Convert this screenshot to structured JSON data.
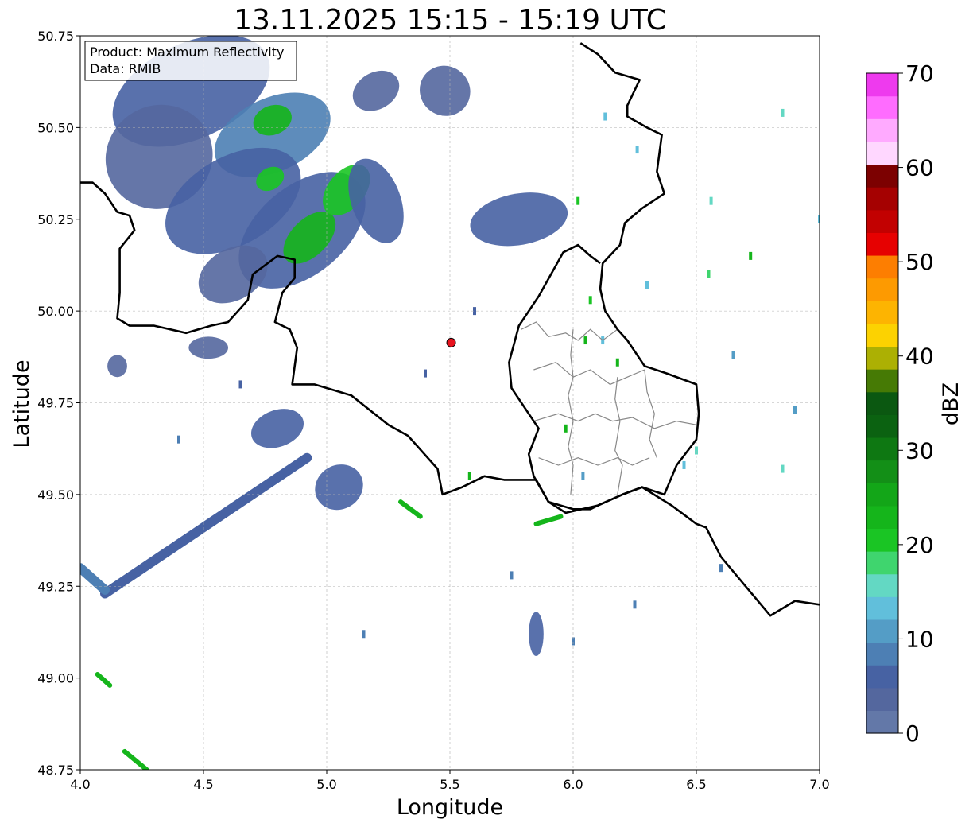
{
  "title": "13.11.2025 15:15 - 15:19 UTC",
  "info_box": {
    "product_line": "Product: Maximum Reflectivity",
    "data_line": "Data: RMIB"
  },
  "axes": {
    "xlabel": "Longitude",
    "ylabel": "Latitude",
    "xlim": [
      4.0,
      7.0
    ],
    "ylim": [
      48.75,
      50.75
    ],
    "xticks": [
      4.0,
      4.5,
      5.0,
      5.5,
      6.0,
      6.5,
      7.0
    ],
    "xtick_labels": [
      "4.0",
      "4.5",
      "5.0",
      "5.5",
      "6.0",
      "6.5",
      "7.0"
    ],
    "yticks": [
      48.75,
      49.0,
      49.25,
      49.5,
      49.75,
      50.0,
      50.25,
      50.5,
      50.75
    ],
    "ytick_labels": [
      "48.75",
      "49.00",
      "49.25",
      "49.50",
      "49.75",
      "50.00",
      "50.25",
      "50.50",
      "50.75"
    ],
    "grid": true
  },
  "colorbar": {
    "label": "dBZ",
    "range": [
      0,
      70
    ],
    "tick_values": [
      0,
      10,
      20,
      30,
      40,
      50,
      60,
      70
    ],
    "tick_labels": [
      "0",
      "10",
      "20",
      "30",
      "40",
      "50",
      "60",
      "70"
    ],
    "colors": [
      "#6378a8",
      "#54679e",
      "#4762a3",
      "#4d7fb4",
      "#549dc6",
      "#61bfdb",
      "#63d8c3",
      "#3fd56e",
      "#1ac524",
      "#15b51b",
      "#13a618",
      "#138f17",
      "#0e7812",
      "#0b6211",
      "#0b5811",
      "#467a05",
      "#acb003",
      "#fcd201",
      "#fdb401",
      "#fd9a01",
      "#fd7e01",
      "#e60101",
      "#c20101",
      "#a50101",
      "#7c0101",
      "#ffd7ff",
      "#ffaaff",
      "#ff6cff",
      "#ee3aee"
    ]
  },
  "radar_site": {
    "lon": 5.505,
    "lat": 49.914,
    "color": "#e8141e"
  },
  "colors": {
    "border": "#000000",
    "admin_border": "#888888",
    "grid": "#b0b0b0"
  },
  "map": {
    "borders": [
      [
        [
          4.0,
          50.35
        ],
        [
          4.05,
          50.35
        ],
        [
          4.1,
          50.32
        ],
        [
          4.15,
          50.27
        ],
        [
          4.2,
          50.26
        ],
        [
          4.22,
          50.22
        ],
        [
          4.16,
          50.17
        ],
        [
          4.16,
          50.05
        ],
        [
          4.15,
          49.98
        ],
        [
          4.2,
          49.96
        ],
        [
          4.3,
          49.96
        ],
        [
          4.43,
          49.94
        ],
        [
          4.53,
          49.96
        ],
        [
          4.6,
          49.97
        ],
        [
          4.68,
          50.03
        ],
        [
          4.7,
          50.1
        ],
        [
          4.8,
          50.15
        ],
        [
          4.87,
          50.14
        ],
        [
          4.87,
          50.09
        ],
        [
          4.82,
          50.05
        ],
        [
          4.79,
          49.97
        ],
        [
          4.85,
          49.95
        ],
        [
          4.88,
          49.9
        ],
        [
          4.86,
          49.8
        ],
        [
          4.95,
          49.8
        ],
        [
          5.1,
          49.77
        ],
        [
          5.25,
          49.69
        ],
        [
          5.33,
          49.66
        ],
        [
          5.45,
          49.57
        ],
        [
          5.47,
          49.5
        ],
        [
          5.55,
          49.52
        ],
        [
          5.64,
          49.55
        ],
        [
          5.72,
          49.54
        ],
        [
          5.85,
          49.54
        ],
        [
          5.9,
          49.48
        ],
        [
          6.0,
          49.46
        ],
        [
          6.07,
          49.46
        ],
        [
          6.1,
          49.47
        ],
        [
          6.2,
          49.5
        ],
        [
          6.28,
          49.52
        ],
        [
          6.4,
          49.47
        ],
        [
          6.5,
          49.42
        ],
        [
          6.54,
          49.41
        ],
        [
          6.6,
          49.33
        ],
        [
          6.7,
          49.25
        ],
        [
          6.8,
          49.17
        ],
        [
          6.9,
          49.21
        ],
        [
          7.0,
          49.2
        ]
      ],
      [
        [
          6.03,
          50.73
        ],
        [
          6.1,
          50.7
        ],
        [
          6.17,
          50.65
        ],
        [
          6.27,
          50.63
        ],
        [
          6.22,
          50.56
        ],
        [
          6.22,
          50.53
        ],
        [
          6.3,
          50.5
        ],
        [
          6.36,
          50.48
        ],
        [
          6.34,
          50.38
        ],
        [
          6.37,
          50.32
        ],
        [
          6.28,
          50.28
        ],
        [
          6.21,
          50.24
        ],
        [
          6.19,
          50.18
        ],
        [
          6.12,
          50.13
        ],
        [
          6.11,
          50.06
        ],
        [
          6.13,
          50.0
        ],
        [
          6.18,
          49.95
        ],
        [
          6.22,
          49.92
        ],
        [
          6.29,
          49.85
        ],
        [
          6.38,
          49.83
        ],
        [
          6.5,
          49.8
        ],
        [
          6.51,
          49.72
        ],
        [
          6.5,
          49.65
        ],
        [
          6.42,
          49.58
        ],
        [
          6.37,
          49.5
        ],
        [
          6.28,
          49.52
        ],
        [
          6.2,
          49.5
        ],
        [
          6.1,
          49.47
        ],
        [
          5.97,
          49.45
        ],
        [
          5.9,
          49.48
        ],
        [
          5.84,
          49.55
        ],
        [
          5.82,
          49.61
        ],
        [
          5.86,
          49.68
        ],
        [
          5.75,
          49.79
        ],
        [
          5.74,
          49.86
        ],
        [
          5.78,
          49.96
        ],
        [
          5.86,
          50.04
        ],
        [
          5.96,
          50.16
        ],
        [
          6.02,
          50.18
        ],
        [
          6.07,
          50.15
        ],
        [
          6.11,
          50.13
        ]
      ]
    ],
    "admin_lines": [
      [
        [
          5.79,
          49.95
        ],
        [
          5.85,
          49.97
        ],
        [
          5.9,
          49.93
        ],
        [
          5.97,
          49.94
        ],
        [
          6.02,
          49.92
        ],
        [
          6.07,
          49.95
        ],
        [
          6.12,
          49.92
        ],
        [
          6.18,
          49.95
        ]
      ],
      [
        [
          5.84,
          49.84
        ],
        [
          5.93,
          49.86
        ],
        [
          6.0,
          49.82
        ],
        [
          6.07,
          49.84
        ],
        [
          6.15,
          49.8
        ],
        [
          6.22,
          49.82
        ],
        [
          6.29,
          49.84
        ]
      ],
      [
        [
          5.84,
          49.7
        ],
        [
          5.94,
          49.72
        ],
        [
          6.02,
          49.7
        ],
        [
          6.09,
          49.72
        ],
        [
          6.16,
          49.7
        ],
        [
          6.24,
          49.71
        ],
        [
          6.33,
          49.68
        ],
        [
          6.42,
          49.7
        ],
        [
          6.5,
          49.69
        ]
      ],
      [
        [
          5.86,
          49.6
        ],
        [
          5.94,
          49.58
        ],
        [
          6.02,
          49.6
        ],
        [
          6.1,
          49.58
        ],
        [
          6.18,
          49.6
        ],
        [
          6.24,
          49.58
        ],
        [
          6.31,
          49.6
        ]
      ],
      [
        [
          6.0,
          49.95
        ],
        [
          5.99,
          49.88
        ],
        [
          6.0,
          49.82
        ],
        [
          5.98,
          49.77
        ],
        [
          6.0,
          49.7
        ],
        [
          5.98,
          49.63
        ],
        [
          6.0,
          49.58
        ],
        [
          5.99,
          49.5
        ]
      ],
      [
        [
          6.18,
          49.82
        ],
        [
          6.17,
          49.76
        ],
        [
          6.19,
          49.7
        ],
        [
          6.17,
          49.62
        ],
        [
          6.2,
          49.58
        ],
        [
          6.18,
          49.5
        ]
      ],
      [
        [
          6.29,
          49.84
        ],
        [
          6.3,
          49.78
        ],
        [
          6.33,
          49.72
        ],
        [
          6.31,
          49.65
        ],
        [
          6.34,
          49.6
        ]
      ]
    ],
    "echoes": [
      {
        "lon": 4.45,
        "lat": 50.6,
        "rx": 0.34,
        "ry": 0.13,
        "rot": -25,
        "dbz": 5
      },
      {
        "lon": 4.78,
        "lat": 50.48,
        "rx": 0.25,
        "ry": 0.1,
        "rot": -25,
        "dbz": 8
      },
      {
        "lon": 4.78,
        "lat": 50.52,
        "rx": 0.08,
        "ry": 0.04,
        "rot": -20,
        "dbz": 22
      },
      {
        "lon": 4.32,
        "lat": 50.42,
        "rx": 0.22,
        "ry": 0.14,
        "rot": -30,
        "dbz": 4
      },
      {
        "lon": 4.62,
        "lat": 50.3,
        "rx": 0.3,
        "ry": 0.12,
        "rot": -30,
        "dbz": 5
      },
      {
        "lon": 4.77,
        "lat": 50.36,
        "rx": 0.06,
        "ry": 0.03,
        "rot": -30,
        "dbz": 20
      },
      {
        "lon": 4.9,
        "lat": 50.22,
        "rx": 0.3,
        "ry": 0.12,
        "rot": -40,
        "dbz": 7
      },
      {
        "lon": 4.93,
        "lat": 50.2,
        "rx": 0.13,
        "ry": 0.05,
        "rot": -45,
        "dbz": 22
      },
      {
        "lon": 5.08,
        "lat": 50.33,
        "rx": 0.12,
        "ry": 0.05,
        "rot": -50,
        "dbz": 20
      },
      {
        "lon": 4.62,
        "lat": 50.1,
        "rx": 0.15,
        "ry": 0.07,
        "rot": -30,
        "dbz": 4
      },
      {
        "lon": 5.2,
        "lat": 50.3,
        "rx": 0.1,
        "ry": 0.12,
        "rot": -20,
        "dbz": 5
      },
      {
        "lon": 5.78,
        "lat": 50.25,
        "rx": 0.2,
        "ry": 0.07,
        "rot": -10,
        "dbz": 5
      },
      {
        "lon": 5.48,
        "lat": 50.6,
        "rx": 0.1,
        "ry": 0.07,
        "rot": -50,
        "dbz": 4
      },
      {
        "lon": 5.2,
        "lat": 50.6,
        "rx": 0.1,
        "ry": 0.05,
        "rot": -30,
        "dbz": 4
      },
      {
        "lon": 4.8,
        "lat": 49.68,
        "rx": 0.11,
        "ry": 0.05,
        "rot": -20,
        "dbz": 6
      },
      {
        "lon": 5.05,
        "lat": 49.52,
        "rx": 0.1,
        "ry": 0.06,
        "rot": -30,
        "dbz": 7
      },
      {
        "lon": 5.85,
        "lat": 49.12,
        "rx": 0.03,
        "ry": 0.06,
        "rot": 0,
        "dbz": 6
      },
      {
        "lon": 4.52,
        "lat": 49.9,
        "rx": 0.08,
        "ry": 0.03,
        "rot": 0,
        "dbz": 3
      },
      {
        "lon": 4.15,
        "lat": 49.85,
        "rx": 0.04,
        "ry": 0.03,
        "rot": 0,
        "dbz": 4
      }
    ],
    "streaks": [
      {
        "lon1": 4.1,
        "lat1": 49.23,
        "lon2": 4.92,
        "lat2": 49.6,
        "dbz": 5,
        "width": 4
      },
      {
        "lon1": 4.0,
        "lat1": 49.3,
        "lon2": 4.1,
        "lat2": 49.24,
        "dbz": 8,
        "width": 4
      },
      {
        "lon1": 4.07,
        "lat1": 49.01,
        "lon2": 4.12,
        "lat2": 48.98,
        "dbz": 22,
        "width": 2
      },
      {
        "lon1": 4.18,
        "lat1": 48.8,
        "lon2": 4.27,
        "lat2": 48.75,
        "dbz": 22,
        "width": 2
      },
      {
        "lon1": 5.3,
        "lat1": 49.48,
        "lon2": 5.38,
        "lat2": 49.44,
        "dbz": 22,
        "width": 2
      },
      {
        "lon1": 5.85,
        "lat1": 49.42,
        "lon2": 5.95,
        "lat2": 49.44,
        "dbz": 24,
        "width": 2
      }
    ],
    "specks": [
      {
        "lon": 6.26,
        "lat": 50.44,
        "dbz": 14
      },
      {
        "lon": 6.56,
        "lat": 50.3,
        "dbz": 16
      },
      {
        "lon": 6.72,
        "lat": 50.15,
        "dbz": 22
      },
      {
        "lon": 6.55,
        "lat": 50.1,
        "dbz": 18
      },
      {
        "lon": 6.3,
        "lat": 50.07,
        "dbz": 14
      },
      {
        "lon": 6.07,
        "lat": 50.03,
        "dbz": 20
      },
      {
        "lon": 6.12,
        "lat": 49.92,
        "dbz": 14
      },
      {
        "lon": 6.18,
        "lat": 49.86,
        "dbz": 22
      },
      {
        "lon": 6.85,
        "lat": 49.57,
        "dbz": 16
      },
      {
        "lon": 6.45,
        "lat": 49.58,
        "dbz": 14
      },
      {
        "lon": 5.58,
        "lat": 49.55,
        "dbz": 24
      },
      {
        "lon": 6.04,
        "lat": 49.55,
        "dbz": 10
      },
      {
        "lon": 5.97,
        "lat": 49.68,
        "dbz": 22
      },
      {
        "lon": 6.5,
        "lat": 49.62,
        "dbz": 16
      },
      {
        "lon": 6.85,
        "lat": 50.54,
        "dbz": 16
      },
      {
        "lon": 6.13,
        "lat": 50.53,
        "dbz": 14
      },
      {
        "lon": 6.02,
        "lat": 50.3,
        "dbz": 20
      },
      {
        "lon": 5.75,
        "lat": 49.28,
        "dbz": 8
      },
      {
        "lon": 6.05,
        "lat": 49.92,
        "dbz": 22
      },
      {
        "lon": 5.6,
        "lat": 50.0,
        "dbz": 6
      },
      {
        "lon": 5.4,
        "lat": 49.83,
        "dbz": 6
      },
      {
        "lon": 6.25,
        "lat": 49.2,
        "dbz": 8
      },
      {
        "lon": 6.6,
        "lat": 49.3,
        "dbz": 8
      },
      {
        "lon": 5.15,
        "lat": 49.12,
        "dbz": 8
      },
      {
        "lon": 4.4,
        "lat": 49.65,
        "dbz": 8
      },
      {
        "lon": 4.65,
        "lat": 49.8,
        "dbz": 6
      },
      {
        "lon": 6.0,
        "lat": 49.1,
        "dbz": 8
      },
      {
        "lon": 6.9,
        "lat": 49.73,
        "dbz": 12
      },
      {
        "lon": 6.65,
        "lat": 49.88,
        "dbz": 10
      },
      {
        "lon": 7.0,
        "lat": 50.25,
        "dbz": 14
      }
    ]
  }
}
